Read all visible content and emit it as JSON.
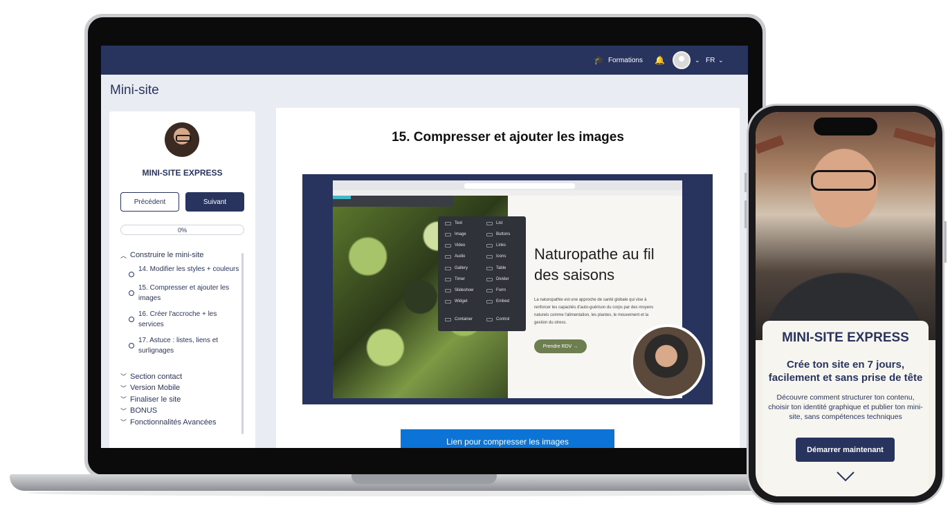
{
  "app": {
    "header": {
      "formations_label": "Formations",
      "language": "FR"
    },
    "page_title": "Mini-site"
  },
  "sidebar": {
    "course_name": "MINI-SITE EXPRESS",
    "prev_label": "Précédent",
    "next_label": "Suivant",
    "progress": "0%",
    "outline": {
      "open_section": "Construire le mini-site",
      "lessons": [
        "14. Modifier les styles + couleurs",
        "15. Compresser et ajouter les images",
        "16. Créer l'accroche + les services",
        "17. Astuce : listes, liens et surlignages"
      ],
      "sections": [
        "Section contact",
        "Version Mobile",
        "Finaliser le site",
        "BONUS",
        "Fonctionnalités Avancées"
      ]
    }
  },
  "lesson": {
    "title": "15. Compresser et ajouter les images",
    "link_button": "Lien pour compresser les images",
    "video": {
      "menu_items_left": [
        "Text",
        "Image",
        "Video",
        "Audio",
        "Gallery",
        "Timer",
        "Slideshow",
        "Widget",
        "Container"
      ],
      "menu_items_right": [
        "List",
        "Buttons",
        "Links",
        "Icons",
        "Table",
        "Divider",
        "Form",
        "Embed",
        "Control"
      ],
      "hero_title": "Naturopathe au fil des saisons",
      "hero_text": "La naturopathie est une approche de santé globale qui vise à renforcer les capacités d'auto-guérison du corps par des moyens naturels comme l'alimentation, les plantes, le mouvement et la gestion du stress.",
      "hero_button": "Prendre RDV  →"
    }
  },
  "phone": {
    "title": "MINI-SITE EXPRESS",
    "subtitle": "Crée ton site en 7 jours, facilement et sans prise de tête",
    "description": "Découvre comment structurer ton contenu, choisir ton identité graphique et publier ton mini-site,  sans compétences techniques",
    "cta": "Démarrer maintenant"
  },
  "colors": {
    "brand_navy": "#29345e",
    "link_blue": "#0b74d6",
    "hero_green": "#6d7f4e"
  },
  "icons": [
    "graduation-cap-icon",
    "bell-icon",
    "avatar",
    "chevron-down-icon",
    "chevron-up-icon",
    "circle-icon"
  ]
}
